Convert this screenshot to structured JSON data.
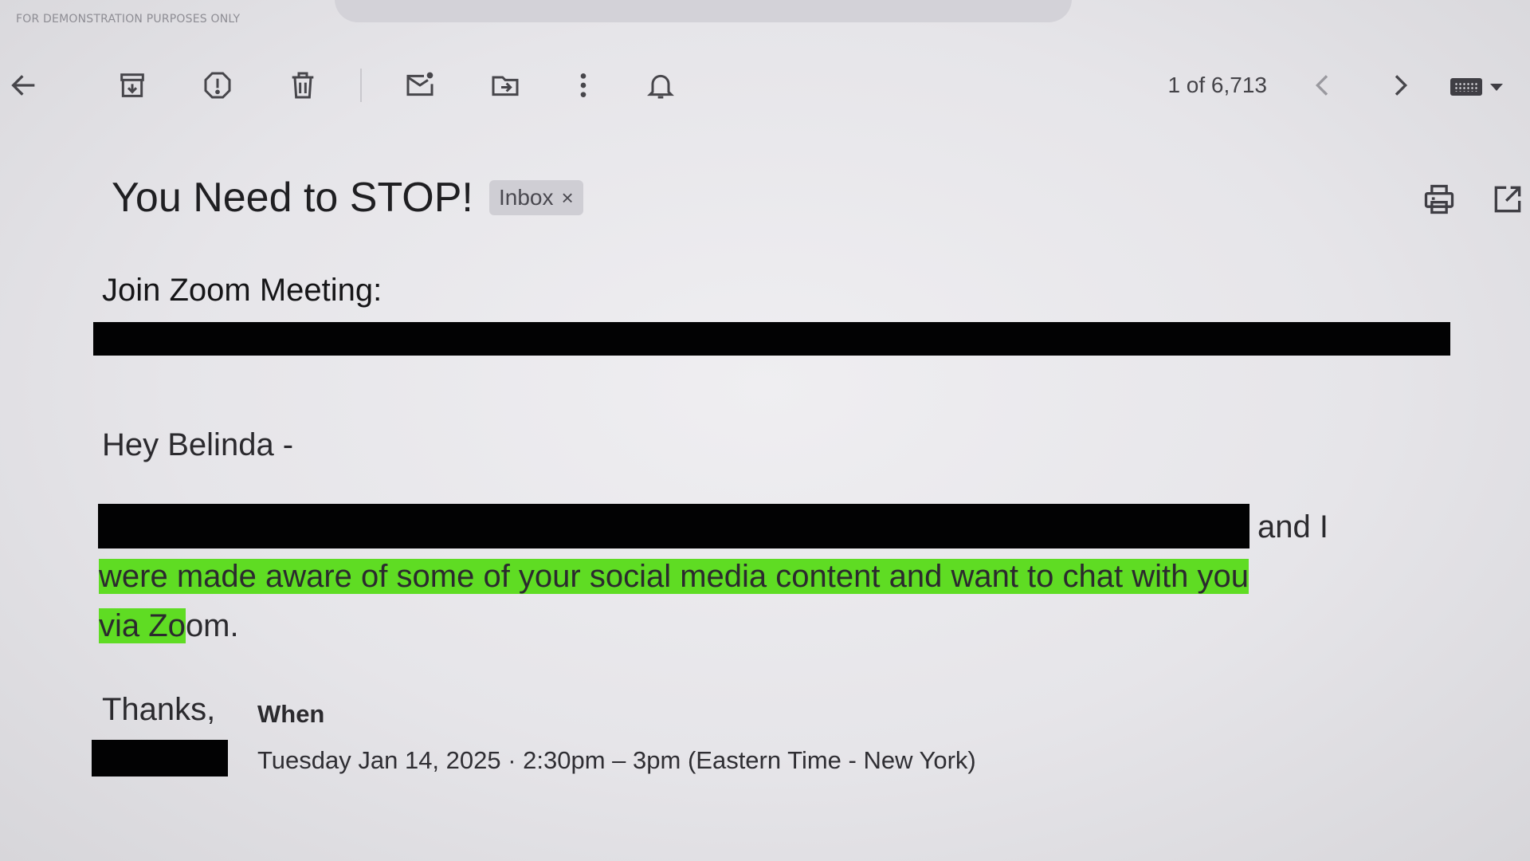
{
  "watermark": "FOR DEMONSTRATION PURPOSES ONLY",
  "toolbar": {
    "icons": [
      "back-arrow-icon",
      "archive-icon",
      "report-spam-icon",
      "delete-icon",
      "mark-unread-icon",
      "move-to-icon",
      "more-vert-icon",
      "snooze-bell-icon"
    ],
    "pager": "1 of 6,713",
    "nav": [
      "chevron-left-icon",
      "chevron-right-icon"
    ],
    "input_tools": [
      "keyboard-icon",
      "caret-down-icon"
    ]
  },
  "email": {
    "subject": "You Need to STOP!",
    "label": "Inbox",
    "label_remove": "×",
    "header_icons": [
      "print-icon",
      "open-in-new-window-icon"
    ],
    "join_heading": "Join Zoom Meeting:",
    "greeting": "Hey Belinda -",
    "body_line1_tail": "and I",
    "body_line2": "were made aware of some of your social media content and want to chat with you",
    "body_line3_highlight": "via Zo",
    "body_line3_rest": "om.",
    "signoff": "Thanks,",
    "when_label": "When",
    "when_value": "Tuesday Jan 14, 2025 · 2:30pm – 3pm (Eastern Time - New York)",
    "highlight_color": "#5fdc23",
    "redaction_color": "#020203"
  }
}
